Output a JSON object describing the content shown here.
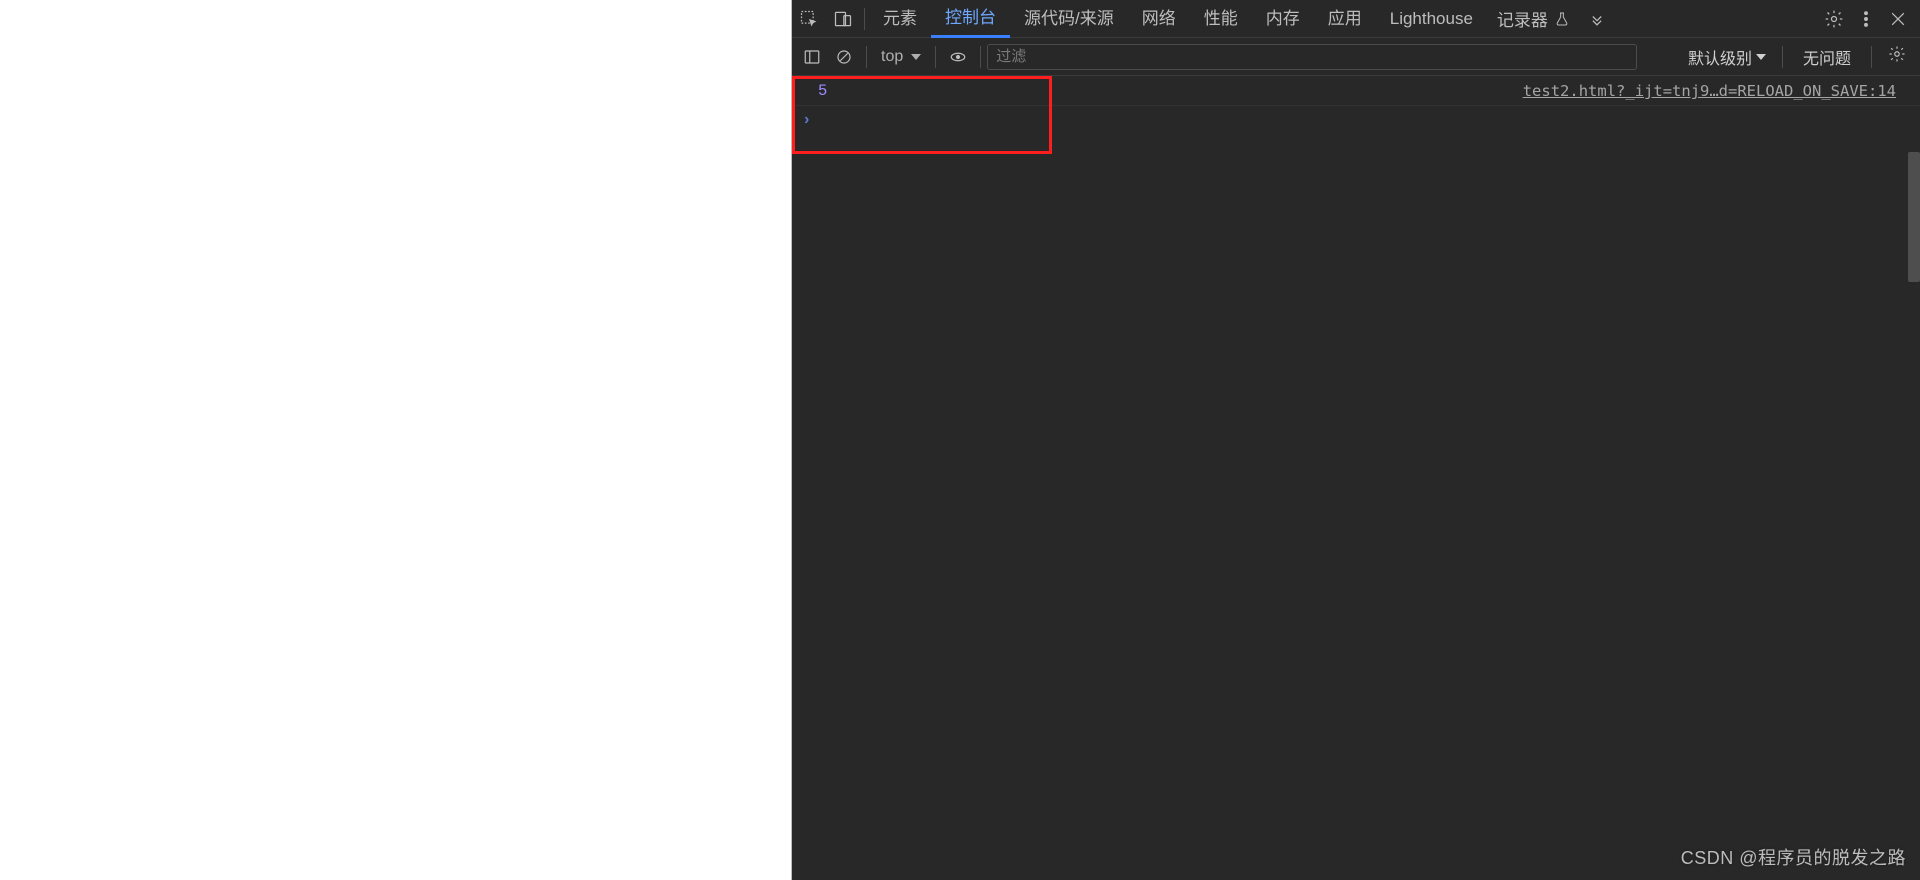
{
  "tabs": {
    "elements": "元素",
    "console": "控制台",
    "sources": "源代码/来源",
    "network": "网络",
    "performance": "性能",
    "memory": "内存",
    "application": "应用",
    "lighthouse": "Lighthouse",
    "recorder": "记录器"
  },
  "active_tab": "console",
  "console_toolbar": {
    "context": "top",
    "filter_placeholder": "过滤",
    "level_label": "默认级别",
    "issues_label": "无问题"
  },
  "console": {
    "log_value": "5",
    "source_link": "test2.html?_ijt=tnj9…d=RELOAD_ON_SAVE:14",
    "prompt_symbol": "›"
  },
  "watermark": "CSDN @程序员的脱发之路"
}
